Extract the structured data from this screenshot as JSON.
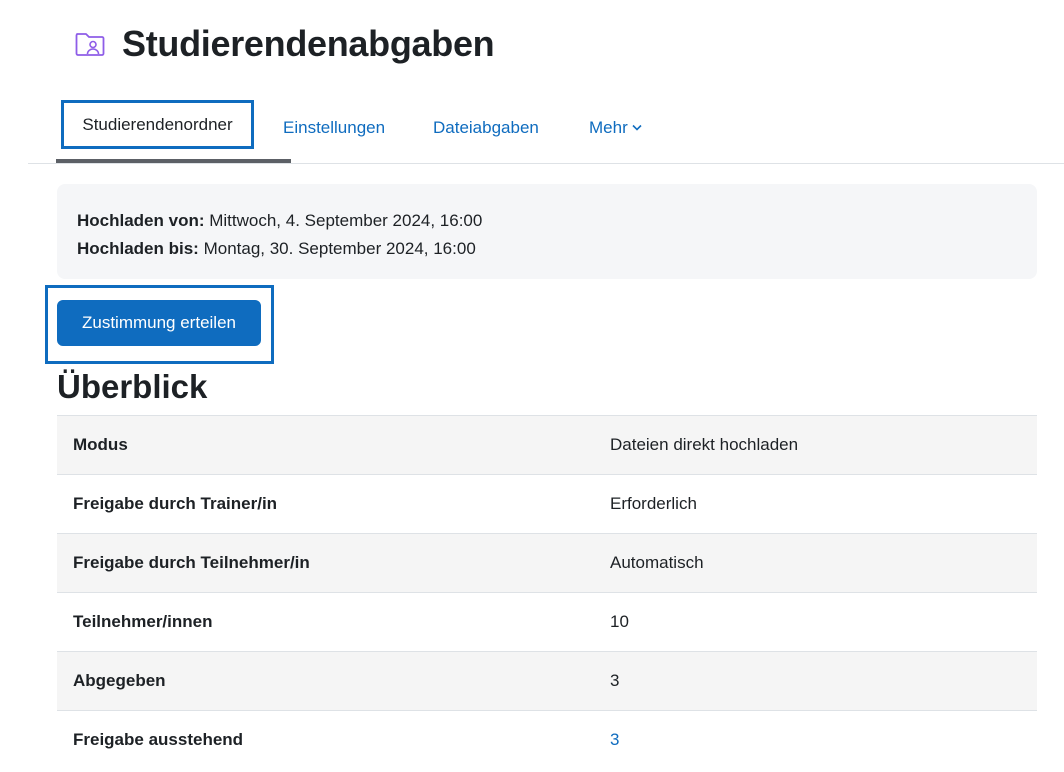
{
  "header": {
    "title": "Studierendenabgaben",
    "icon": "folder-user-icon"
  },
  "tabs": [
    {
      "label": "Studierendenordner",
      "active": true
    },
    {
      "label": "Einstellungen",
      "active": false
    },
    {
      "label": "Dateiabgaben",
      "active": false
    },
    {
      "label": "Mehr",
      "active": false,
      "dropdown": true
    }
  ],
  "dates": {
    "from_label": "Hochladen von:",
    "from_value": " Mittwoch, 4. September 2024, 16:00",
    "to_label": "Hochladen bis:",
    "to_value": " Montag, 30. September 2024, 16:00"
  },
  "consent_button": "Zustimmung erteilen",
  "overview": {
    "title": "Überblick",
    "rows": [
      {
        "label": "Modus",
        "value": "Dateien direkt hochladen"
      },
      {
        "label": "Freigabe durch Trainer/in",
        "value": "Erforderlich"
      },
      {
        "label": "Freigabe durch Teilnehmer/in",
        "value": "Automatisch"
      },
      {
        "label": "Teilnehmer/innen",
        "value": "10"
      },
      {
        "label": "Abgegeben",
        "value": "3"
      },
      {
        "label": "Freigabe ausstehend",
        "value": "3",
        "link": true
      }
    ]
  },
  "colors": {
    "accent": "#0f6cbf",
    "icon_purple": "#8e5de8",
    "text": "#1d2125",
    "row_shade": "#f5f5f5"
  }
}
